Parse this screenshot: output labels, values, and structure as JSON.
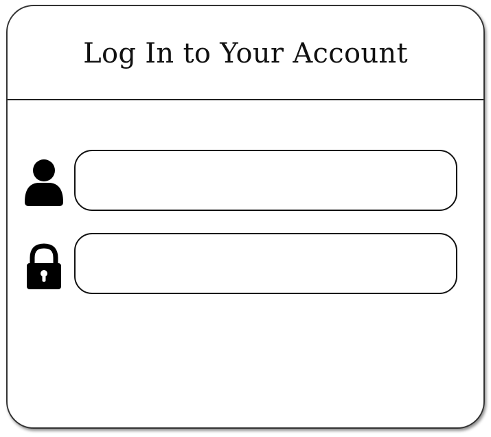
{
  "header": {
    "title": "Log In to Your Account"
  },
  "form": {
    "username": {
      "icon": "user-icon",
      "value": "",
      "placeholder": ""
    },
    "password": {
      "icon": "lock-icon",
      "value": "",
      "placeholder": ""
    }
  },
  "colors": {
    "border": "#111111",
    "background": "#ffffff",
    "icon": "#000000"
  }
}
